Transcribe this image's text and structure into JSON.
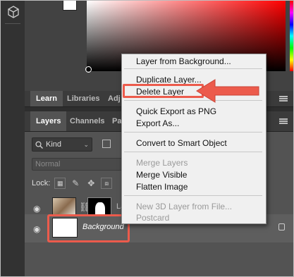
{
  "panels": {
    "top_tabs": [
      {
        "label": "Learn",
        "active": true
      },
      {
        "label": "Libraries",
        "active": false
      },
      {
        "label": "Adj",
        "active": false
      }
    ],
    "layer_tabs": [
      {
        "label": "Layers",
        "active": true
      },
      {
        "label": "Channels",
        "active": false
      },
      {
        "label": "Pa",
        "active": false
      }
    ]
  },
  "filter": {
    "kind_label": "Kind"
  },
  "blend_mode": "Normal",
  "lock_label": "Lock:",
  "layers": [
    {
      "name_cut": "La",
      "visible": true
    },
    {
      "name": "Background",
      "visible": true,
      "locked": true,
      "selected": true
    }
  ],
  "context_menu": {
    "items": [
      {
        "label": "Layer from Background...",
        "enabled": true
      },
      {
        "label": "Duplicate Layer...",
        "enabled": true
      },
      {
        "label": "Delete Layer",
        "enabled": true,
        "highlighted": true
      },
      {
        "label": "Quick Export as PNG",
        "enabled": true
      },
      {
        "label": "Export As...",
        "enabled": true
      },
      {
        "label": "Convert to Smart Object",
        "enabled": true
      },
      {
        "label": "Merge Layers",
        "enabled": false
      },
      {
        "label": "Merge Visible",
        "enabled": true
      },
      {
        "label": "Flatten Image",
        "enabled": true
      },
      {
        "label": "New 3D Layer from File...",
        "enabled": false
      },
      {
        "label": "Postcard",
        "enabled": false
      }
    ]
  },
  "colors": {
    "annotation": "#ec5b4c",
    "foreground": "#ffffff",
    "background": "#000000"
  },
  "icons": [
    "cube-icon",
    "eye-icon",
    "chain-icon",
    "search-icon",
    "image-filter-icon",
    "lock-transparent-icon",
    "brush-icon",
    "move-icon",
    "artboard-icon",
    "panel-menu-icon",
    "lock-icon"
  ]
}
